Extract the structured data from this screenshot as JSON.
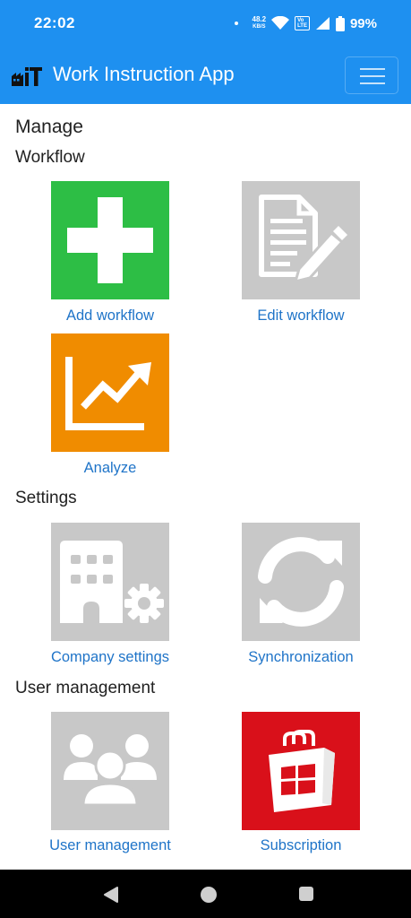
{
  "status_bar": {
    "time": "22:02",
    "net_speed_value": "48.2",
    "net_speed_unit": "KB/S",
    "volte_label": "Vo\nLTE",
    "battery": "99%"
  },
  "app_bar": {
    "title": "Work Instruction App",
    "logo_text": "iT"
  },
  "page": {
    "heading": "Manage"
  },
  "sections": {
    "workflow": {
      "title": "Workflow",
      "add_workflow": {
        "label": "Add workflow",
        "icon": "plus-icon",
        "color": "#2DBE45"
      },
      "edit_workflow": {
        "label": "Edit workflow",
        "icon": "document-edit-icon",
        "color": "#C8C8C8"
      },
      "analyze": {
        "label": "Analyze",
        "icon": "trend-chart-icon",
        "color": "#F08C00"
      }
    },
    "settings": {
      "title": "Settings",
      "company_settings": {
        "label": "Company settings",
        "icon": "building-gear-icon",
        "color": "#C8C8C8"
      },
      "synchronization": {
        "label": "Synchronization",
        "icon": "sync-icon",
        "color": "#C8C8C8"
      }
    },
    "user_management": {
      "title": "User management",
      "user_management": {
        "label": "User management",
        "icon": "users-icon",
        "color": "#C8C8C8"
      },
      "subscription": {
        "label": "Subscription",
        "icon": "store-bag-icon",
        "color": "#D9101A"
      }
    }
  },
  "colors": {
    "primary": "#1E90F0",
    "link": "#1F74C8",
    "nav_bar": "#000000"
  }
}
